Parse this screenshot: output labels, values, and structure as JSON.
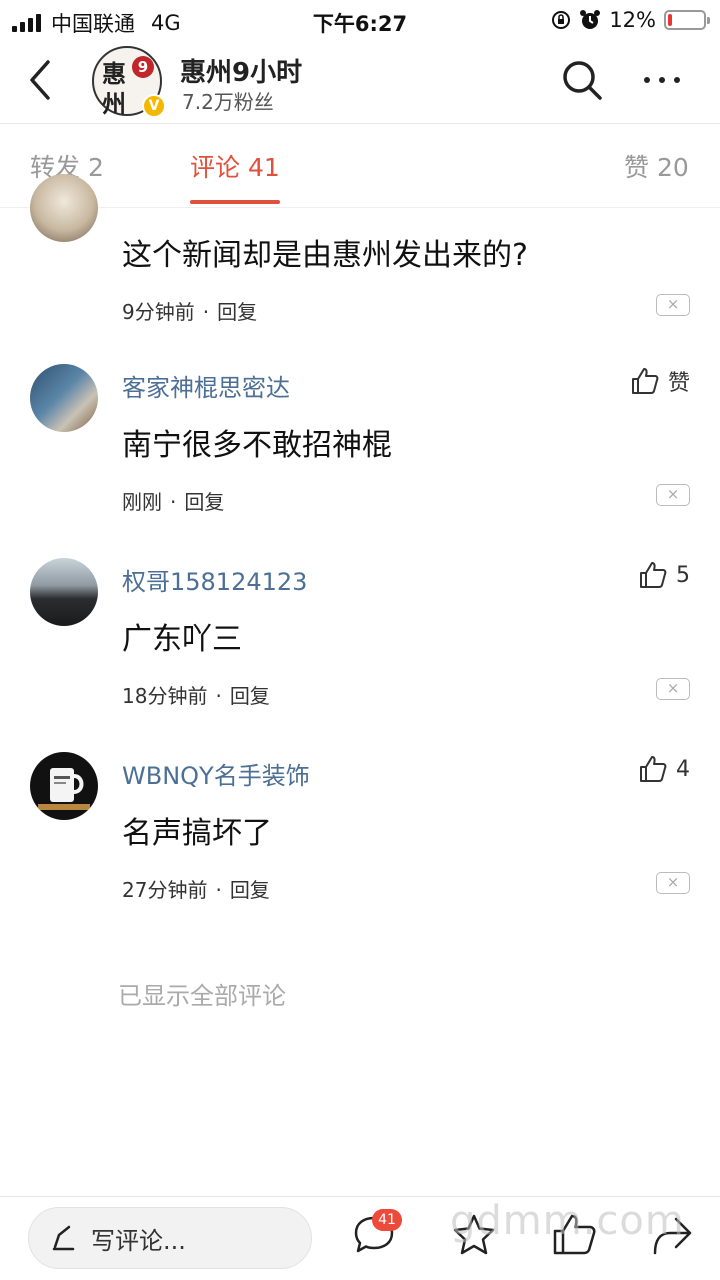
{
  "status_bar": {
    "carrier": "中国联通",
    "network": "4G",
    "time": "下午6:27",
    "battery": "12%",
    "battery_level": 0.12
  },
  "header": {
    "account_name": "惠州9小时",
    "fans": "7.2万粉丝",
    "avatar_text": {
      "char1": "惠",
      "char2": "州",
      "num": "9"
    }
  },
  "tabs": [
    {
      "label": "转发 2"
    },
    {
      "label": "评论 41"
    },
    {
      "label": "赞 20"
    }
  ],
  "comments": [
    {
      "user": "",
      "text": "这个新闻却是由惠州发出来的?",
      "time": "9分钟前",
      "reply": "回复",
      "likes": "",
      "close": "×"
    },
    {
      "user": "客家神棍思密达",
      "text": "南宁很多不敢招神棍",
      "time": "刚刚",
      "reply": "回复",
      "likes": "赞",
      "close": "×"
    },
    {
      "user": "权哥158124123",
      "text": "广东吖三",
      "time": "18分钟前",
      "reply": "回复",
      "likes": "5",
      "close": "×"
    },
    {
      "user": "WBNQY名手装饰",
      "text": "名声搞坏了",
      "time": "27分钟前",
      "reply": "回复",
      "likes": "4",
      "close": "×"
    }
  ],
  "all_shown": "已显示全部评论",
  "bottom_bar": {
    "write_comment": "写评论...",
    "comment_badge": "41"
  },
  "watermark": "gdmm.com",
  "colors": {
    "accent": "#e0503c",
    "username": "#4c6f96",
    "badge": "#ee4a3a",
    "verified": "#f5b800"
  }
}
